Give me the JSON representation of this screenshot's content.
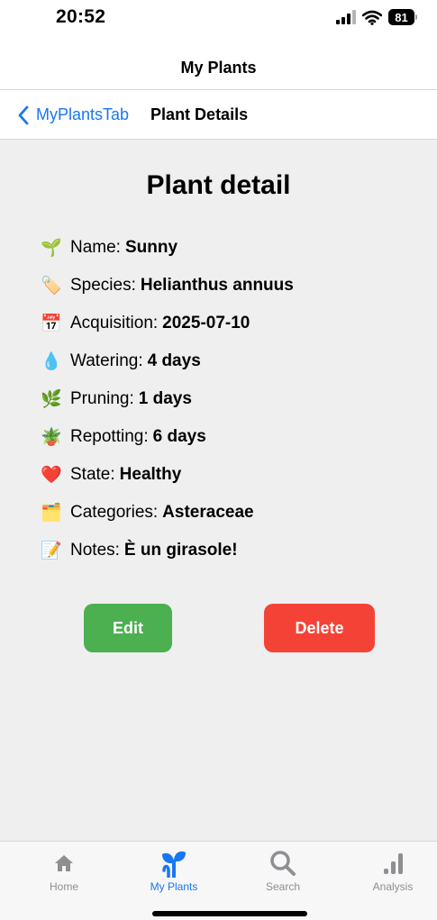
{
  "status_bar": {
    "time": "20:52",
    "battery": "81"
  },
  "app_title": "My Plants",
  "nav": {
    "back_label": "MyPlantsTab",
    "title": "Plant Details"
  },
  "page": {
    "heading": "Plant detail",
    "details": [
      {
        "emoji": "🌱",
        "icon": "seedling-icon",
        "label": "Name:",
        "value": "Sunny"
      },
      {
        "emoji": "🏷️",
        "icon": "tag-icon",
        "label": "Species:",
        "value": "Helianthus annuus"
      },
      {
        "emoji": "📅",
        "icon": "calendar-icon",
        "label": "Acquisition:",
        "value": "2025-07-10"
      },
      {
        "emoji": "💧",
        "icon": "droplet-icon",
        "label": "Watering:",
        "value": "4 days"
      },
      {
        "emoji": "🌿",
        "icon": "herb-icon",
        "label": "Pruning:",
        "value": "1 days"
      },
      {
        "emoji": "🪴",
        "icon": "potted-plant-icon",
        "label": "Repotting:",
        "value": "6 days"
      },
      {
        "emoji": "❤️",
        "icon": "heart-icon",
        "label": "State:",
        "value": "Healthy"
      },
      {
        "emoji": "🗂️",
        "icon": "folder-icon",
        "label": "Categories:",
        "value": "Asteraceae"
      },
      {
        "emoji": "📝",
        "icon": "memo-icon",
        "label": "Notes:",
        "value": "È un girasole!"
      }
    ],
    "edit_label": "Edit",
    "delete_label": "Delete"
  },
  "tabs": [
    {
      "label": "Home",
      "icon": "home-icon",
      "active": false
    },
    {
      "label": "My Plants",
      "icon": "plant-icon",
      "active": true
    },
    {
      "label": "Search",
      "icon": "search-icon",
      "active": false
    },
    {
      "label": "Analysis",
      "icon": "chart-icon",
      "active": false
    }
  ],
  "colors": {
    "accent": "#1877f2",
    "edit_button": "#4caf50",
    "delete_button": "#f44336",
    "content_background": "#efefef",
    "inactive_tab": "#8e8e93"
  }
}
